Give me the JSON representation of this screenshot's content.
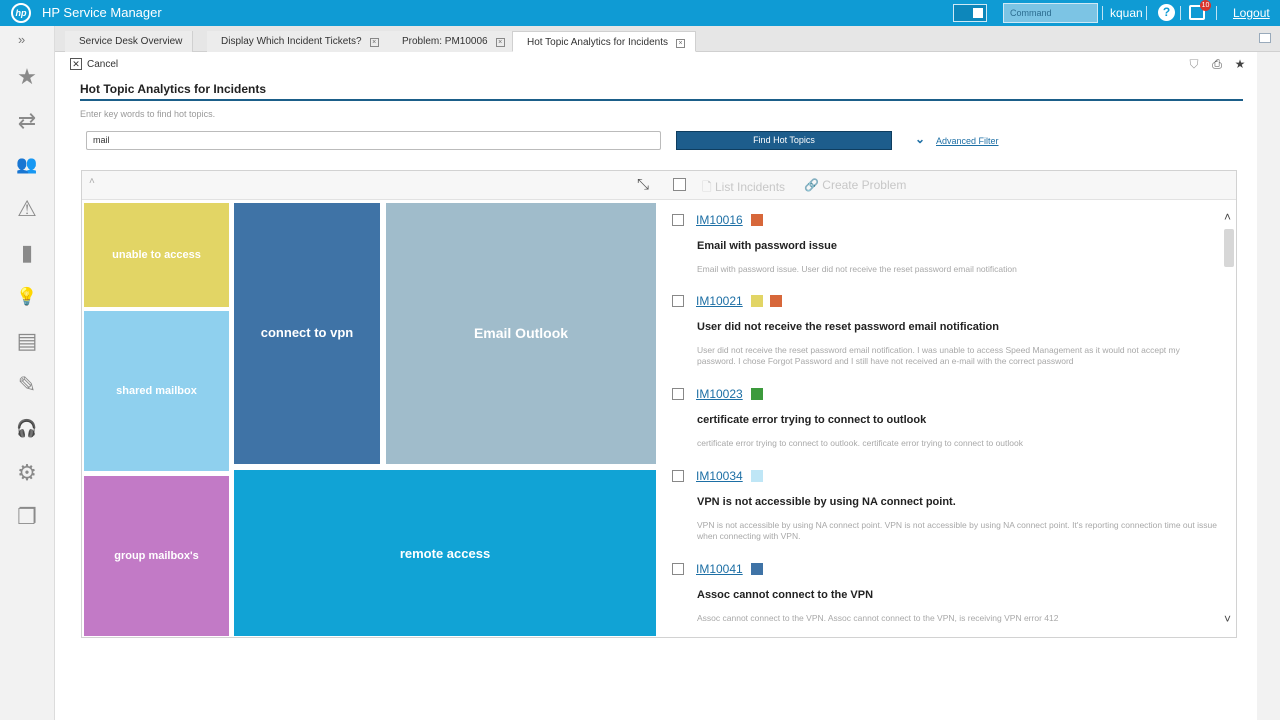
{
  "header": {
    "logo_text": "hp",
    "app_title": "HP Service Manager",
    "command_placeholder": "Command",
    "username": "kquan",
    "help_glyph": "?",
    "notification_count": "10",
    "logout_label": "Logout"
  },
  "nav": {
    "expand_glyph": "»",
    "items": [
      {
        "icon": "star-icon",
        "glyph": "★"
      },
      {
        "icon": "swap-icon",
        "glyph": "⇄"
      },
      {
        "icon": "users-icon",
        "glyph": "👥"
      },
      {
        "icon": "warning-icon",
        "glyph": "⚠"
      },
      {
        "icon": "book-icon",
        "glyph": "▮"
      },
      {
        "icon": "lightbulb-icon",
        "glyph": "💡"
      },
      {
        "icon": "dashboard-icon",
        "glyph": "▤"
      },
      {
        "icon": "edit-form-icon",
        "glyph": "✎"
      },
      {
        "icon": "headset-icon",
        "glyph": "🎧"
      },
      {
        "icon": "gear-box-icon",
        "glyph": "⚙"
      },
      {
        "icon": "copy-icon",
        "glyph": "❐"
      }
    ]
  },
  "tabs": [
    {
      "label": "Service Desk Overview",
      "closable": false
    },
    {
      "label": "Display Which Incident Tickets?",
      "closable": true
    },
    {
      "label": "Problem: PM10006",
      "closable": true
    },
    {
      "label": "Hot Topic Analytics for Incidents",
      "closable": true,
      "active": true
    }
  ],
  "toolbar": {
    "cancel_glyph": "✕",
    "cancel_label": "Cancel"
  },
  "page": {
    "title": "Hot Topic Analytics for Incidents",
    "hint": "Enter key words to find hot topics.",
    "search_value": "mail",
    "find_button": "Find Hot Topics",
    "advanced_filter": "Advanced Filter"
  },
  "panel": {
    "list_incidents": "List Incidents",
    "create_problem": "Create Problem"
  },
  "treemap": [
    {
      "label": "unable to access",
      "color": "#e2d565"
    },
    {
      "label": "shared mailbox",
      "color": "#8fd0ee"
    },
    {
      "label": "group mailbox's",
      "color": "#c27ac6"
    },
    {
      "label": "connect to vpn",
      "color": "#3f73a6"
    },
    {
      "label": "Email Outlook",
      "color": "#a0bccb"
    },
    {
      "label": "remote access",
      "color": "#11a3d5"
    }
  ],
  "incidents": [
    {
      "id": "IM10016",
      "colors": [
        "#d7673a"
      ],
      "title": "Email with password issue",
      "desc": "Email with password issue. User did not receive the reset password email notification"
    },
    {
      "id": "IM10021",
      "colors": [
        "#e2d565",
        "#d7673a"
      ],
      "title": "User did not receive the reset password email notification",
      "desc": "User did not receive the reset password email notification. I was unable to access Speed Management as it would not accept my password. I chose Forgot Password and I still have not received an e-mail with the correct password"
    },
    {
      "id": "IM10023",
      "colors": [
        "#3c9a3c"
      ],
      "title": "certificate error trying to connect to outlook",
      "desc": "certificate error trying to connect to outlook. certificate error trying to connect to outlook"
    },
    {
      "id": "IM10034",
      "colors": [
        "#bfe6f6"
      ],
      "title": "VPN is not accessible by using NA connect point.",
      "desc": "VPN is not accessible by using NA connect point. VPN is not accessible by using NA connect point. It's reporting connection time out issue when connecting with VPN."
    },
    {
      "id": "IM10041",
      "colors": [
        "#3f73a6"
      ],
      "title": "Assoc cannot connect to the VPN",
      "desc": "Assoc cannot connect to the VPN. Assoc cannot connect to the VPN, is receiving VPN error 412"
    }
  ]
}
